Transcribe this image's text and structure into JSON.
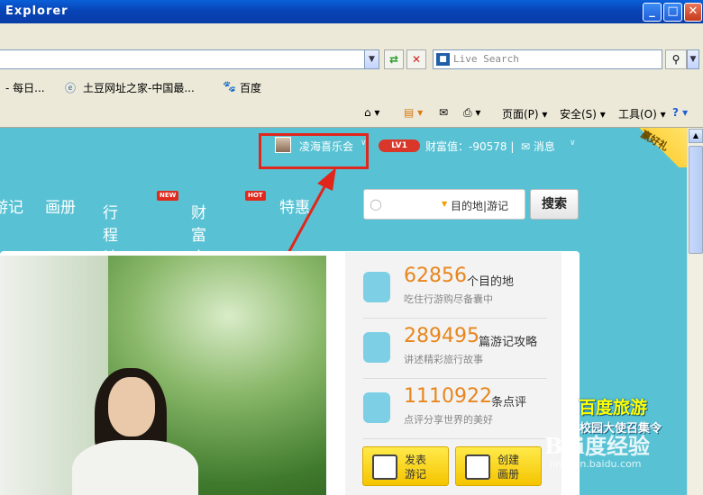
{
  "window": {
    "title": "Explorer"
  },
  "addressbar": {
    "live_search_placeholder": "Live Search"
  },
  "favorites": {
    "items": [
      "- 每日...",
      "土豆网址之家-中国最...",
      "百度"
    ]
  },
  "commandbar": {
    "page": "页面(P)",
    "safety": "安全(S)",
    "tools": "工具(O)"
  },
  "site": {
    "user_name": "凌海喜乐会",
    "level": "LV1",
    "wealth": "财富值：-90578 |",
    "messages": "消息",
    "corner_text": "赢好礼",
    "nav": [
      {
        "label": "游记"
      },
      {
        "label": "画册"
      },
      {
        "label": "行程计划",
        "badge": "NEW"
      },
      {
        "label": "财富商城",
        "badge": "HOT"
      },
      {
        "label": "特惠"
      }
    ],
    "search_scope": "目的地|游记",
    "search_button": "搜索",
    "stats": [
      {
        "number": "62856",
        "unit": "个目的地",
        "sub": "吃住行游购尽备囊中"
      },
      {
        "number": "289495",
        "unit": "篇游记攻略",
        "sub": "讲述精彩旅行故事"
      },
      {
        "number": "1110922",
        "unit": "条点评",
        "sub": "点评分享世界的美好"
      }
    ],
    "actions": [
      {
        "line1": "发表",
        "line2": "游记"
      },
      {
        "line1": "创建",
        "line2": "画册"
      }
    ],
    "promo_title": "百度旅游",
    "promo_sub": "校园大使召集令"
  },
  "watermark": {
    "logo": "Bai度经验",
    "url": "jingyan.baidu.com"
  }
}
